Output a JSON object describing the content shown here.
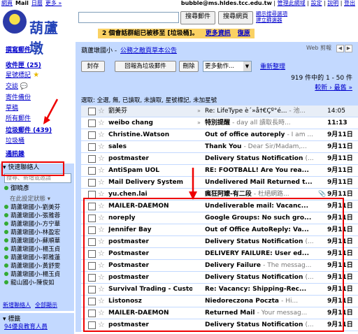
{
  "top_nav": {
    "left_links": [
      "網頁",
      "Mail",
      "日曆",
      "更多 »"
    ],
    "account": "bubble@ms.hldes.tcc.edu.tw",
    "right_links": [
      "管理此網域",
      "設定",
      "說明",
      "登出"
    ]
  },
  "logo": {
    "text": "葫蘆墩"
  },
  "search": {
    "value": "",
    "search_mail_label": "搜尋郵件",
    "search_web_label": "搜尋網頁",
    "links": [
      "顯示搜尋選項",
      "建立篩選器"
    ]
  },
  "notice": {
    "text": "2 個會話群組已被移至 [垃圾桶]。",
    "link": "更多資訊",
    "undo": "復原"
  },
  "sidebar": {
    "compose": "撰寫郵件",
    "items": [
      {
        "label": "收件匣 (25)",
        "bold": true
      },
      {
        "label": "星號標記",
        "icon": "star-icon"
      },
      {
        "label": "交談",
        "icon": "chat-icon"
      },
      {
        "label": "寄件備份"
      },
      {
        "label": "草稿"
      },
      {
        "label": "所有郵件"
      },
      {
        "label": "垃圾郵件 (439)",
        "bold": true
      },
      {
        "label": "垃圾桶"
      }
    ],
    "contacts_link": "通訊錄",
    "quick_contacts": {
      "title": "快速聯絡人",
      "search_placeholder": "搜尋、新增或邀請",
      "me": "御曉彥",
      "status": "在此設定狀態",
      "list": [
        "葫蘆墩國小-劉美芬",
        "葫蘆墩國小-張雅蓉",
        "葫蘆墩國小-方宁華",
        "葫蘆墩國小-林盈宏",
        "葫蘆墩國小-蘇順華",
        "葫蘆墩國小-楊玉貞",
        "葫蘆墩國小-郭雅蓮",
        "葫蘆墩國小-黃舒雯",
        "葫蘆墩國小-楊玉貞",
        "龍山國小-陳俊如"
      ],
      "footer": [
        "新增聯絡人",
        "全部顯示"
      ]
    },
    "labels": {
      "title": "標籤",
      "item": "94優良教育人員"
    }
  },
  "main": {
    "breadcrumb_prefix": "葫蘆墩國小",
    "breadcrumb_link": "公務之敵頁草本公告",
    "web_clip": "Web 剪報",
    "toolbar": {
      "archive": "封存",
      "not_spam": "回報為垃圾郵件",
      "delete": "刪除",
      "more_actions": "更多動作...",
      "refresh": "重新整理"
    },
    "count": "919 件中的 1 - 50 件",
    "paging": "較新 › 最舊 »",
    "select": "選取: 全選, 無, 已讀取, 未讀取, 星號標記, 未加星號"
  },
  "emails": [
    {
      "sender": "劉美芬",
      "subject": "Re: LifeType è´»å†€Çº°é...",
      "snippet": "- 池...",
      "date": "14:05",
      "unread": false,
      "arrow": true
    },
    {
      "sender": "weibo chang",
      "subject": "特別提醒",
      "snippet": "- day all 讀取長時...",
      "date": "11:13",
      "unread": true,
      "arrow": true
    },
    {
      "sender": "Christine.Watson",
      "subject": "Out of office autoreply",
      "snippet": "- I am ...",
      "date": "9月11日",
      "unread": true
    },
    {
      "sender": "sales",
      "subject": "Thank You",
      "snippet": "- Dear Sir/Madam,...",
      "date": "9月11日",
      "unread": true
    },
    {
      "sender": "postmaster",
      "subject": "Delivery Status Notification",
      "snippet": "(...",
      "date": "9月11日",
      "unread": true
    },
    {
      "sender": "AntiSpam UOL",
      "subject": "RE: FOOTBALL! Are You rea...",
      "snippet": "",
      "date": "9月11日",
      "unread": true
    },
    {
      "sender": "Mail Delivery System",
      "subject": "Undelivered Mail Returned t...",
      "snippet": "",
      "date": "9月11日",
      "unread": true
    },
    {
      "sender": "yu.chen.lai",
      "subject": "瘋狂阿嬤-有二段",
      "snippet": "- 杜絕網路...",
      "date": "9月11日",
      "unread": true,
      "clip": true
    },
    {
      "sender": "MAILER-DAEMON",
      "subject": "Undeliverable mail: Vacanc...",
      "snippet": "",
      "date": "9月11日",
      "unread": true
    },
    {
      "sender": "noreply",
      "subject": "Google Groups: No such gro...",
      "snippet": "",
      "date": "9月11日",
      "unread": true
    },
    {
      "sender": "Jennifer Bay",
      "subject": "Out of Office AutoReply: Va...",
      "snippet": "",
      "date": "9月11日",
      "unread": true
    },
    {
      "sender": "postmaster",
      "subject": "Delivery Status Notification",
      "snippet": "(...",
      "date": "9月11日",
      "unread": true
    },
    {
      "sender": "Postmaster",
      "subject": "DELIVERY FAILURE: User ed...",
      "snippet": "",
      "date": "9月11日",
      "unread": true
    },
    {
      "sender": "Postmaster",
      "subject": "Delivery Failure",
      "snippet": "- The messag...",
      "date": "9月11日",
      "unread": true
    },
    {
      "sender": "postmaster",
      "subject": "Delivery Status Notification",
      "snippet": "(...",
      "date": "9月11日",
      "unread": true
    },
    {
      "sender": "Survival Trading - Custo.",
      "subject": "Re: Vacancy: Shipping-Rec...",
      "snippet": "",
      "date": "9月11日",
      "unread": true
    },
    {
      "sender": "Listonosz",
      "subject": "Niedoreczona Poczta",
      "snippet": "- Hi...",
      "date": "9月11日",
      "unread": true
    },
    {
      "sender": "MAILER-DAEMON",
      "subject": "Returned Mail",
      "snippet": "- Your messag...",
      "date": "9月11日",
      "unread": true
    },
    {
      "sender": "postmaster",
      "subject": "Delivery Status Notification",
      "snippet": "(...",
      "date": "9月11日",
      "unread": true
    }
  ],
  "colors": {
    "accent": "#c3d9ff",
    "highlight": "#ee0000",
    "notice": "#fad163",
    "link": "#0000cc"
  }
}
